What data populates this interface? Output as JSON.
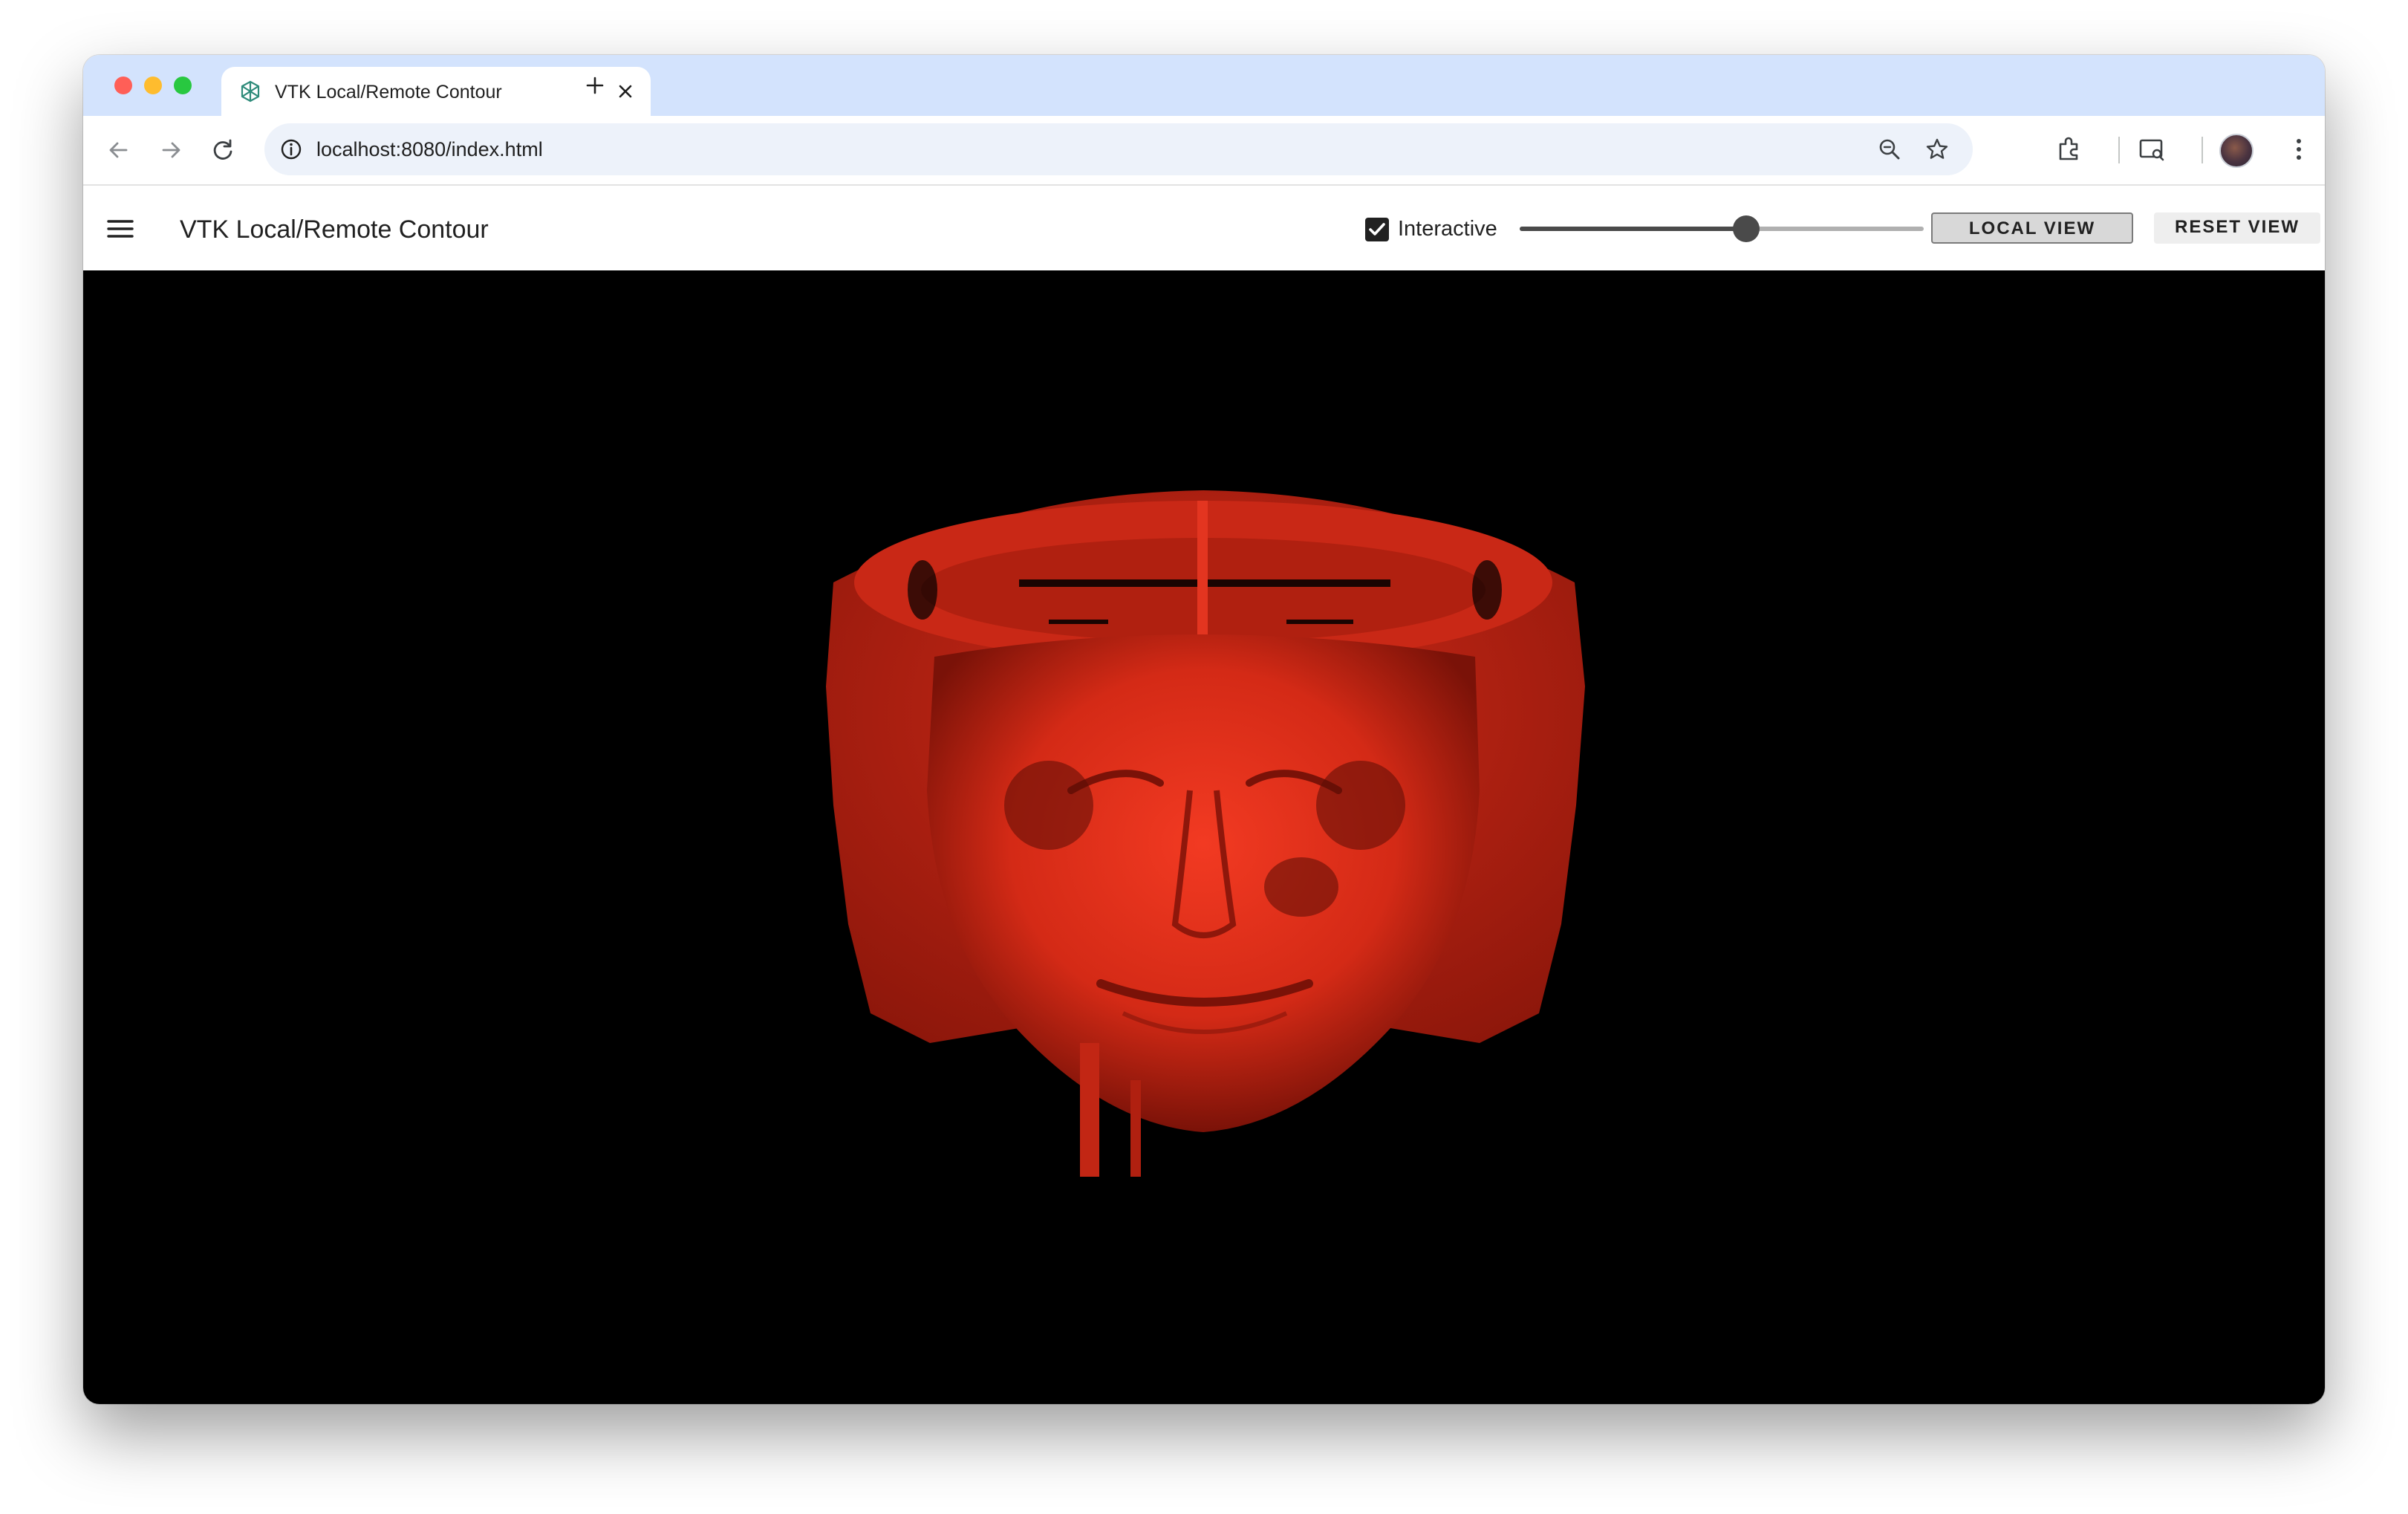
{
  "browser": {
    "tab_title": "VTK Local/Remote Contour",
    "url": "localhost:8080/index.html",
    "icons": [
      "back-arrow-icon",
      "forward-arrow-icon",
      "reload-icon",
      "info-icon",
      "zoom-icon",
      "star-icon",
      "extensions-icon",
      "media-router-icon",
      "profile-avatar",
      "more-menu-icon"
    ]
  },
  "app": {
    "title": "VTK Local/Remote Contour",
    "interactive": {
      "label": "Interactive",
      "checked": true
    },
    "contour_slider": {
      "value_fraction": 0.56
    },
    "buttons": {
      "local_view": "LOCAL VIEW",
      "reset_view": "RESET VIEW"
    }
  },
  "viewport": {
    "background": "#000000",
    "surface_color": "#e0301e"
  }
}
